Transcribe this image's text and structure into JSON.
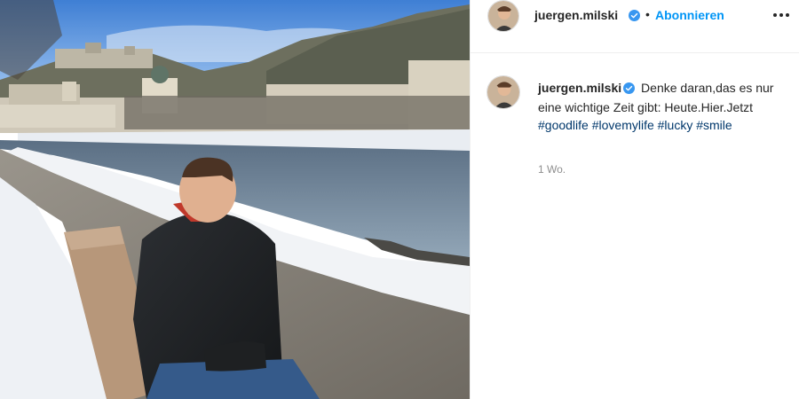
{
  "post": {
    "image_description": "",
    "header": {
      "username": "juergen.milski",
      "separator": "•",
      "follow_label": "Abonnieren",
      "more_icon": "more-horizontal-icon"
    },
    "caption": {
      "username": "juergen.milski",
      "text": "Denke daran,das es nur eine wichtige Zeit gibt: Heute.Hier.Jetzt",
      "hashtags": [
        "#goodlife",
        "#lovemylife",
        "#lucky",
        "#smile"
      ],
      "timestamp": "1 Wo."
    }
  },
  "colors": {
    "accent": "#0095f6",
    "verified": "#3897f0",
    "hashtag": "#00376b",
    "muted": "#8e8e8e"
  }
}
